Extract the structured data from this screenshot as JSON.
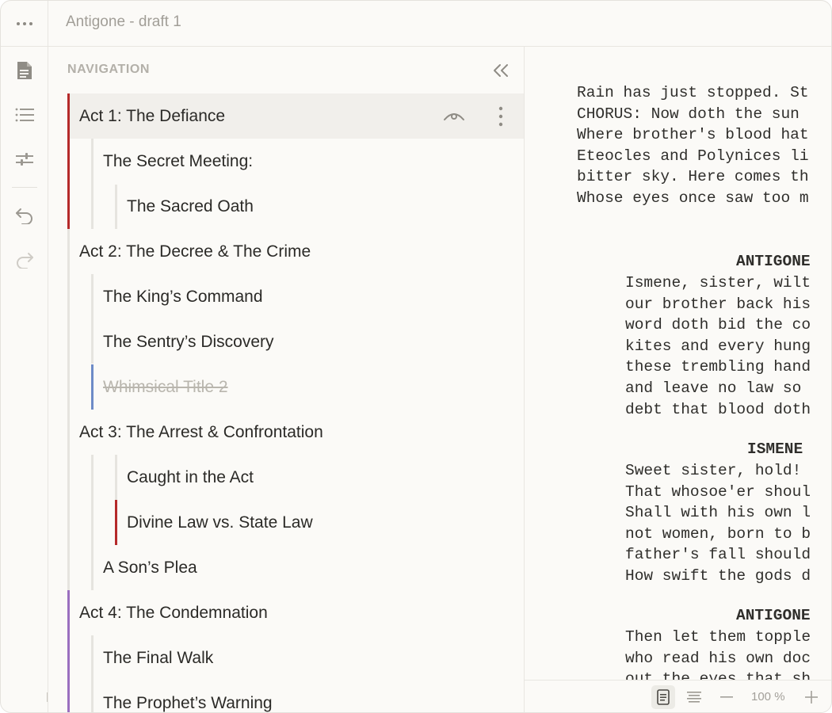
{
  "window": {
    "title": "Antigone - draft 1"
  },
  "rail": {
    "icons": [
      "document-icon",
      "list-icon",
      "sliders-icon",
      "undo-icon",
      "redo-icon"
    ]
  },
  "navigation": {
    "header": "NAVIGATION",
    "items": [
      {
        "label": "Act 1: The Defiance",
        "level": 0,
        "active": true
      },
      {
        "label": "The Secret Meeting:",
        "level": 1
      },
      {
        "label": "The Sacred Oath",
        "level": 2
      },
      {
        "label": "Act 2: The Decree & The Crime",
        "level": 0
      },
      {
        "label": "The King’s Command",
        "level": 1
      },
      {
        "label": "The Sentry’s Discovery",
        "level": 1
      },
      {
        "label": "Whimsical Title 2",
        "level": 1,
        "struck": true
      },
      {
        "label": "Act 3: The Arrest & Confrontation",
        "level": 0
      },
      {
        "label": "Caught in the Act",
        "level": 2
      },
      {
        "label": "Divine Law vs. State Law",
        "level": 2
      },
      {
        "label": "A Son’s Plea",
        "level": 1
      },
      {
        "label": "Act 4: The Condemnation",
        "level": 0
      },
      {
        "label": "The Final Walk",
        "level": 1
      },
      {
        "label": "The Prophet’s Warning",
        "level": 1
      }
    ]
  },
  "colors": {
    "red_marker": "#b52a2a",
    "blue_marker": "#6d8bc7",
    "purple_marker": "#9a6fbf",
    "guide": "#e6e4df"
  },
  "script": {
    "action": "Rain has just stopped. St\nCHORUS: Now doth the sun \nWhere brother's blood hat\nEteocles and Polynices li\nbitter sky. Here comes th\nWhose eyes once saw too m",
    "char1": "ANTIGONE",
    "dialogue1": "Ismene, sister, wilt\nour brother back his\nword doth bid the co\nkites and every hung\nthese trembling hand\nand leave no law so \ndebt that blood doth",
    "char2": "ISMENE",
    "dialogue2": "Sweet sister, hold! \nThat whosoe'er shoul\nShall with his own l\nnot women, born to b\nfather's fall should\nHow swift the gods d",
    "char3": "ANTIGONE",
    "dialogue3": "Then let them topple\nwho read his own doc\nout the eyes that sh"
  },
  "bottombar": {
    "zoom": "100 %"
  }
}
